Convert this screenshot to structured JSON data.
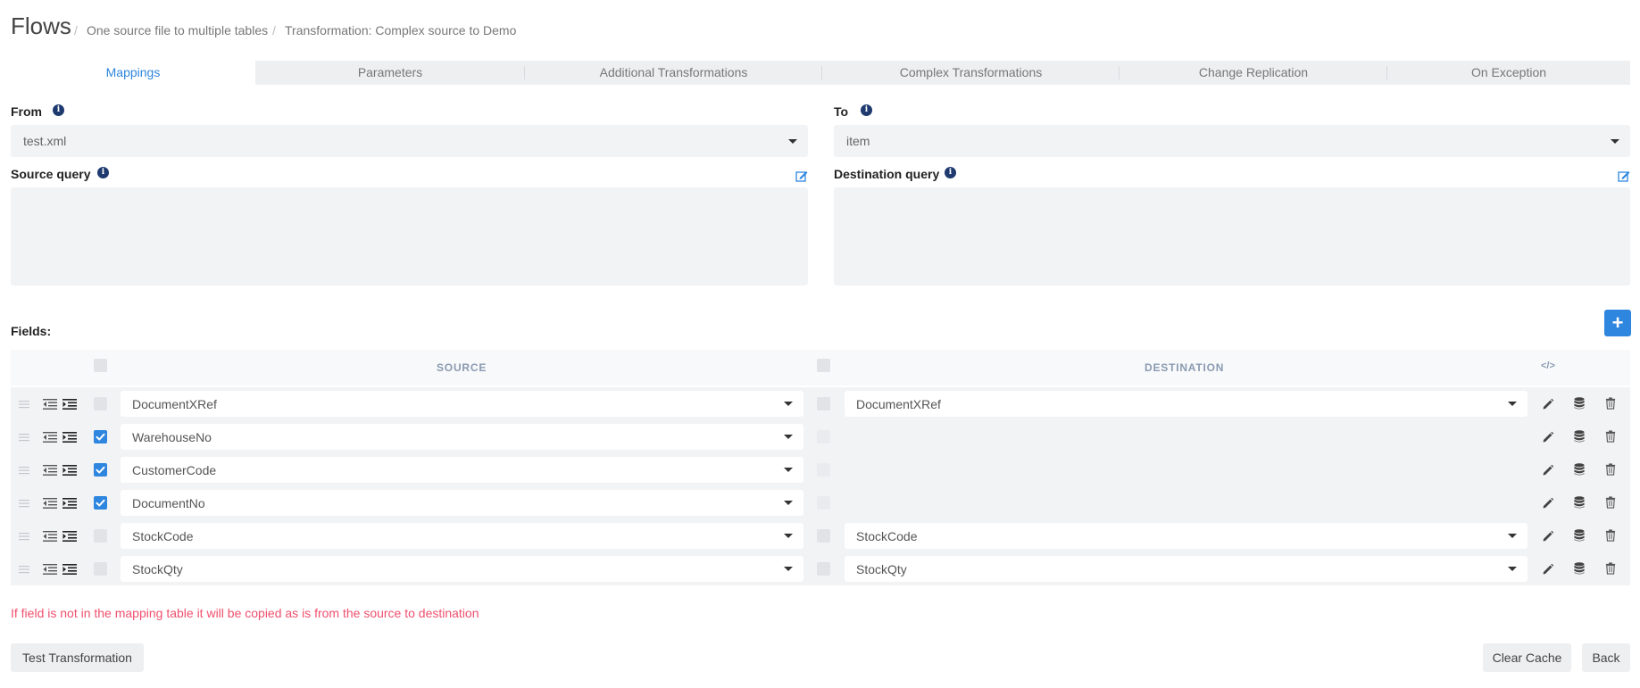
{
  "header": {
    "title": "Flows",
    "breadcrumb": [
      "One source file to multiple tables",
      "Transformation: Complex source to Demo"
    ]
  },
  "tabs": [
    {
      "label": "Mappings",
      "active": true
    },
    {
      "label": "Parameters",
      "active": false
    },
    {
      "label": "Additional Transformations",
      "active": false
    },
    {
      "label": "Complex Transformations",
      "active": false
    },
    {
      "label": "Change Replication",
      "active": false
    },
    {
      "label": "On Exception",
      "active": false
    }
  ],
  "from": {
    "label": "From",
    "value": "test.xml"
  },
  "to": {
    "label": "To",
    "value": "item"
  },
  "source_query": {
    "label": "Source query",
    "value": ""
  },
  "destination_query": {
    "label": "Destination query",
    "value": ""
  },
  "fields": {
    "label": "Fields:",
    "source_header": "SOURCE",
    "destination_header": "DESTINATION",
    "code_icon": "</>",
    "rows": [
      {
        "source": "DocumentXRef",
        "source_checked": false,
        "destination": "DocumentXRef",
        "has_destination": true
      },
      {
        "source": "WarehouseNo",
        "source_checked": true,
        "destination": "",
        "has_destination": false
      },
      {
        "source": "CustomerCode",
        "source_checked": true,
        "destination": "",
        "has_destination": false
      },
      {
        "source": "DocumentNo",
        "source_checked": true,
        "destination": "",
        "has_destination": false
      },
      {
        "source": "StockCode",
        "source_checked": false,
        "destination": "StockCode",
        "has_destination": true
      },
      {
        "source": "StockQty",
        "source_checked": false,
        "destination": "StockQty",
        "has_destination": true
      }
    ]
  },
  "warning": "If field is not in the mapping table it will be copied as is from the source to destination",
  "buttons": {
    "add": "+",
    "test": "Test Transformation",
    "clear_cache": "Clear Cache",
    "back": "Back"
  },
  "colors": {
    "accent": "#2e86de",
    "warning": "#f0506e",
    "info_icon": "#1e3a6e"
  }
}
